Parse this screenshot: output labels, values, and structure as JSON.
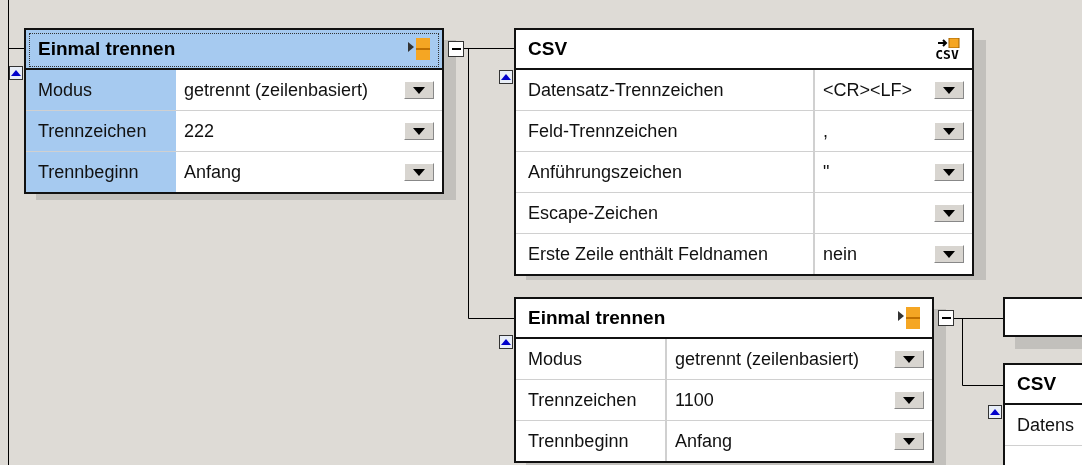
{
  "nodes": [
    {
      "kind": "split",
      "title": "Einmal trennen",
      "selected": true,
      "rows": [
        {
          "label": "Modus",
          "value": "getrennt (zeilenbasiert)"
        },
        {
          "label": "Trennzeichen",
          "value": "222"
        },
        {
          "label": "Trennbeginn",
          "value": "Anfang"
        }
      ]
    },
    {
      "kind": "csv",
      "title": "CSV",
      "icon_text": "CSV",
      "selected": false,
      "rows": [
        {
          "label": "Datensatz-Trennzeichen",
          "value": "<CR><LF>"
        },
        {
          "label": "Feld-Trennzeichen",
          "value": ","
        },
        {
          "label": "Anführungszeichen",
          "value": "\""
        },
        {
          "label": "Escape-Zeichen"
        },
        {
          "label": "Erste Zeile enthält Feldnamen",
          "value": "nein"
        }
      ]
    },
    {
      "kind": "split",
      "title": "Einmal trennen",
      "selected": false,
      "rows": [
        {
          "label": "Modus",
          "value": "getrennt (zeilenbasiert)"
        },
        {
          "label": "Trennzeichen",
          "value": "1100"
        },
        {
          "label": "Trennbeginn",
          "value": "Anfang"
        }
      ]
    },
    {
      "kind": "empty"
    },
    {
      "kind": "cut",
      "title": "CSV",
      "selected": false,
      "rows": [
        {
          "label": "Datens"
        }
      ]
    }
  ]
}
